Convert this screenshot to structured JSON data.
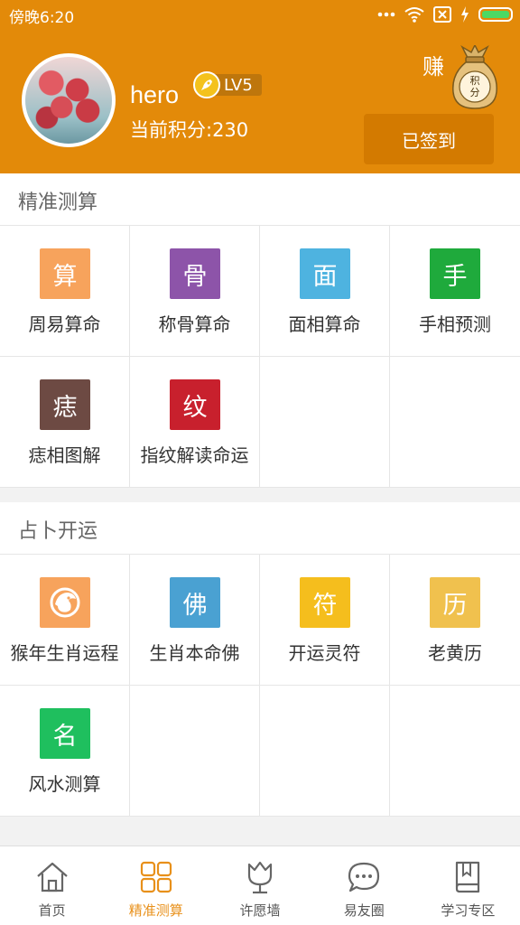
{
  "status_bar": {
    "time": "傍晚6:20"
  },
  "header": {
    "username": "hero",
    "level": "LV5",
    "score": "当前积分:230",
    "earn_label": "赚",
    "bag_text": "积分",
    "checkin_label": "已签到"
  },
  "sections": [
    {
      "title": "精准测算",
      "items": [
        {
          "glyph": "算",
          "label": "周易算命",
          "color": "#f7a35c"
        },
        {
          "glyph": "骨",
          "label": "称骨算命",
          "color": "#8d54a9"
        },
        {
          "glyph": "面",
          "label": "面相算命",
          "color": "#4eb3e0"
        },
        {
          "glyph": "手",
          "label": "手相预测",
          "color": "#1faa3c"
        },
        {
          "glyph": "痣",
          "label": "痣相图解",
          "color": "#6d4a43"
        },
        {
          "glyph": "纹",
          "label": "指纹解读命运",
          "color": "#c8202d"
        }
      ]
    },
    {
      "title": "占卜开运",
      "items": [
        {
          "glyph": "",
          "icon": "monkey-icon",
          "label": "猴年生肖运程",
          "color": "#f7a35c"
        },
        {
          "glyph": "佛",
          "label": "生肖本命佛",
          "color": "#4aa1d2"
        },
        {
          "glyph": "符",
          "label": "开运灵符",
          "color": "#f5be1d"
        },
        {
          "glyph": "历",
          "label": "老黄历",
          "color": "#f0c14e"
        },
        {
          "glyph": "名",
          "label": "风水测算",
          "color": "#1fbf5e"
        }
      ]
    }
  ],
  "tabbar": {
    "tabs": [
      {
        "label": "首页",
        "icon": "home-icon"
      },
      {
        "label": "精准测算",
        "icon": "grid-icon"
      },
      {
        "label": "许愿墙",
        "icon": "tulip-icon"
      },
      {
        "label": "易友圈",
        "icon": "chat-icon"
      },
      {
        "label": "学习专区",
        "icon": "book-icon"
      }
    ],
    "active_color": "#e8901a"
  },
  "colors": {
    "brand": "#e38a09",
    "checkin": "#d37a00"
  }
}
